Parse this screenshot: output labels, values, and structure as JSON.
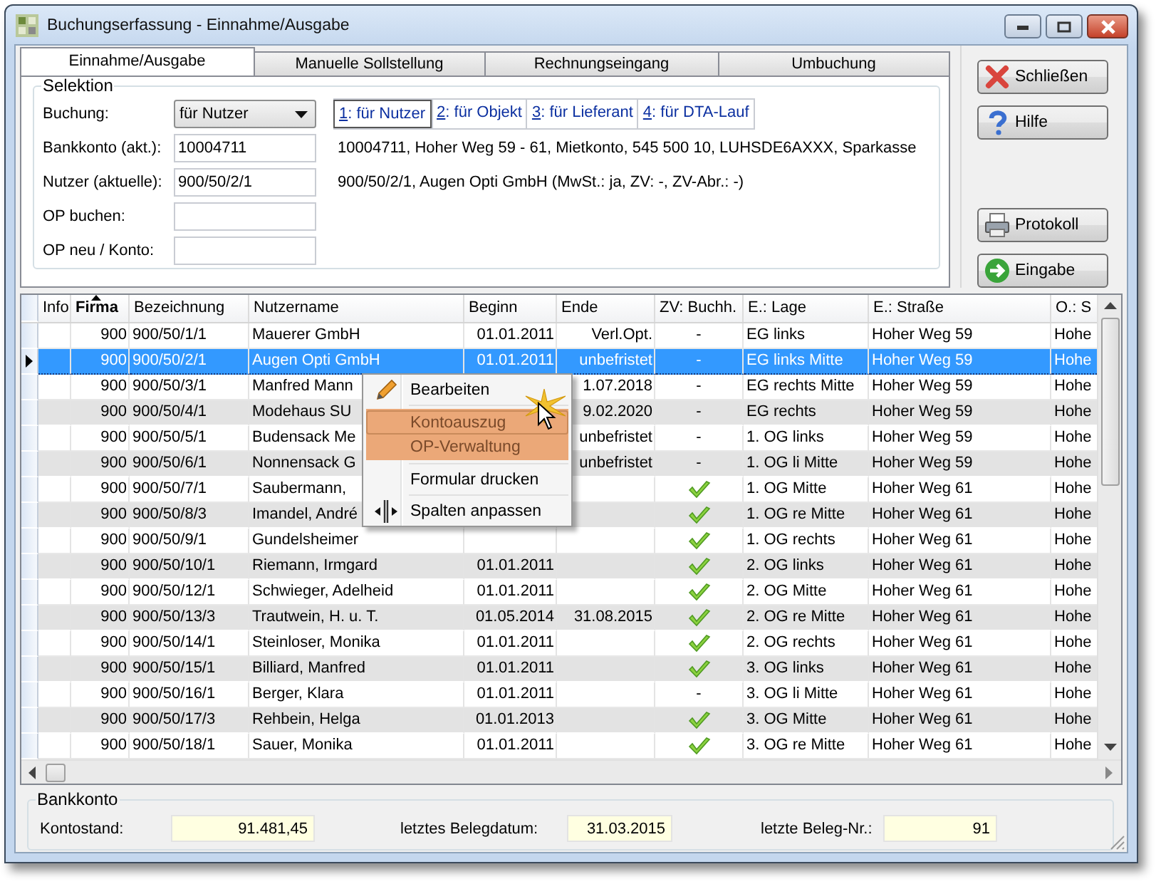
{
  "window": {
    "title": "Buchungserfassung - Einnahme/Ausgabe"
  },
  "tabs": [
    {
      "label": "Einnahme/Ausgabe",
      "selected": true
    },
    {
      "label": "Manuelle Sollstellung",
      "selected": false
    },
    {
      "label": "Rechnungseingang",
      "selected": false
    },
    {
      "label": "Umbuchung",
      "selected": false
    }
  ],
  "selektion": {
    "title": "Selektion",
    "fields": [
      {
        "label": "Buchung:",
        "kind": "dropdown",
        "value": "für Nutzer"
      },
      {
        "label": "Bankkonto (akt.):",
        "kind": "text",
        "value": "10004711",
        "info": "10004711,  Hoher Weg 59 - 61,  Mietkonto,  545 500 10,  LUHSDE6AXXX,  Sparkasse"
      },
      {
        "label": "Nutzer (aktuelle):",
        "kind": "text",
        "value": "900/50/2/1",
        "info": "900/50/2/1,  Augen Opti GmbH  (MwSt.: ja,  ZV: -, ZV-Abr.: -)"
      },
      {
        "label": "OP buchen:",
        "kind": "text"
      },
      {
        "label": "OP neu / Konto:",
        "kind": "text"
      }
    ],
    "links": [
      {
        "key": "1",
        "label": ": für Nutzer",
        "selected": true
      },
      {
        "key": "2",
        "label": ": für Objekt",
        "selected": false
      },
      {
        "key": "3",
        "label": ": für Lieferant",
        "selected": false
      },
      {
        "key": "4",
        "label": ": für DTA-Lauf",
        "selected": false
      }
    ]
  },
  "buttons": [
    {
      "label": "Schließen",
      "kind": "close"
    },
    {
      "label": "Hilfe",
      "kind": "help"
    },
    {
      "label": "Protokoll",
      "kind": "print"
    },
    {
      "label": "Eingabe",
      "kind": "enter"
    }
  ],
  "table": {
    "columns": [
      {
        "label": "Info"
      },
      {
        "label": "Firma",
        "sorted": true
      },
      {
        "label": "Bezeichnung"
      },
      {
        "label": "Nutzername"
      },
      {
        "label": "Beginn"
      },
      {
        "label": "Ende"
      },
      {
        "label": "ZV: Buchh."
      },
      {
        "label": "E.: Lage"
      },
      {
        "label": "E.: Straße"
      },
      {
        "label": "O.: S"
      }
    ],
    "rows": [
      {
        "selected": false,
        "firma": "900",
        "bez": "900/50/1/1",
        "name": "Mauerer GmbH",
        "beginn": "01.01.2011",
        "ende": "Verl.Opt.",
        "zv_booked": false,
        "zv": "-",
        "lage": "EG links",
        "strasse": "Hoher Weg 59",
        "column_10": "Hohe"
      },
      {
        "selected": true,
        "firma": "900",
        "bez": "900/50/2/1",
        "name": "Augen Opti GmbH",
        "beginn": "01.01.2011",
        "ende": "unbefristet",
        "zv_booked": false,
        "zv": "-",
        "lage": "EG links Mitte",
        "strasse": "Hoher Weg 59",
        "column_10": "Hohe"
      },
      {
        "selected": false,
        "firma": "900",
        "bez": "900/50/3/1",
        "name": "Manfred Mann",
        "ende": "1.07.2018",
        "zv_booked": false,
        "zv": "-",
        "lage": "EG rechts Mitte",
        "strasse": "Hoher Weg 59",
        "column_10": "Hohe"
      },
      {
        "selected": false,
        "firma": "900",
        "bez": "900/50/4/1",
        "name": "Modehaus SU",
        "ende": "9.02.2020",
        "zv_booked": false,
        "zv": "-",
        "lage": "EG rechts",
        "strasse": "Hoher Weg 59",
        "column_10": "Hohe"
      },
      {
        "selected": false,
        "firma": "900",
        "bez": "900/50/5/1",
        "name": "Budensack Me",
        "ende": "unbefristet",
        "zv_booked": false,
        "zv": "-",
        "lage": "1. OG links",
        "strasse": "Hoher Weg 59",
        "column_10": "Hohe"
      },
      {
        "selected": false,
        "firma": "900",
        "bez": "900/50/6/1",
        "name": "Nonnensack G",
        "ende": "unbefristet",
        "zv_booked": false,
        "zv": "-",
        "lage": "1. OG li Mitte",
        "strasse": "Hoher Weg 59",
        "column_10": "Hohe"
      },
      {
        "selected": false,
        "firma": "900",
        "bez": "900/50/7/1",
        "name": "Saubermann,",
        "zv_booked": true,
        "lage": "1. OG Mitte",
        "strasse": "Hoher Weg 61",
        "column_10": "Hohe"
      },
      {
        "selected": false,
        "firma": "900",
        "bez": "900/50/8/3",
        "name": "Imandel, André",
        "zv_booked": true,
        "lage": "1. OG re Mitte",
        "strasse": "Hoher Weg 61",
        "column_10": "Hohe"
      },
      {
        "selected": false,
        "firma": "900",
        "bez": "900/50/9/1",
        "name": "Gundelsheimer",
        "zv_booked": true,
        "lage": "1. OG rechts",
        "strasse": "Hoher Weg 61",
        "column_10": "Hohe"
      },
      {
        "selected": false,
        "firma": "900",
        "bez": "900/50/10/1",
        "name": "Riemann, Irmgard",
        "beginn": "01.01.2011",
        "zv_booked": true,
        "lage": "2. OG links",
        "strasse": "Hoher Weg 61",
        "column_10": "Hohe"
      },
      {
        "selected": false,
        "firma": "900",
        "bez": "900/50/12/1",
        "name": "Schwieger, Adelheid",
        "beginn": "01.01.2011",
        "zv_booked": true,
        "lage": "2. OG Mitte",
        "strasse": "Hoher Weg 61",
        "column_10": "Hohe"
      },
      {
        "selected": false,
        "firma": "900",
        "bez": "900/50/13/3",
        "name": "Trautwein, H. u. T.",
        "beginn": "01.05.2014",
        "ende": "31.08.2015",
        "zv_booked": true,
        "lage": "2. OG re Mitte",
        "strasse": "Hoher Weg 61",
        "column_10": "Hohe"
      },
      {
        "selected": false,
        "firma": "900",
        "bez": "900/50/14/1",
        "name": "Steinloser, Monika",
        "beginn": "01.01.2011",
        "zv_booked": true,
        "lage": "2. OG rechts",
        "strasse": "Hoher Weg 61",
        "column_10": "Hohe"
      },
      {
        "selected": false,
        "firma": "900",
        "bez": "900/50/15/1",
        "name": "Billiard, Manfred",
        "beginn": "01.01.2011",
        "zv_booked": true,
        "lage": "3. OG links",
        "strasse": "Hoher Weg 61",
        "column_10": "Hohe"
      },
      {
        "selected": false,
        "firma": "900",
        "bez": "900/50/16/1",
        "name": "Berger, Klara",
        "beginn": "01.01.2011",
        "zv_booked": false,
        "zv": "-",
        "lage": "3. OG li Mitte",
        "strasse": "Hoher Weg 61",
        "column_10": "Hohe"
      },
      {
        "selected": false,
        "firma": "900",
        "bez": "900/50/17/3",
        "name": "Rehbein, Helga",
        "beginn": "01.01.2013",
        "zv_booked": true,
        "lage": "3. OG Mitte",
        "strasse": "Hoher Weg 61",
        "column_10": "Hohe"
      },
      {
        "selected": false,
        "firma": "900",
        "bez": "900/50/18/1",
        "name": "Sauer, Monika",
        "beginn": "01.01.2011",
        "zv_booked": true,
        "lage": "3. OG re Mitte",
        "strasse": "Hoher Weg 61",
        "column_10": "Hohe"
      }
    ]
  },
  "context_menu": {
    "items": [
      {
        "label": "Bearbeiten",
        "kind": "edit",
        "highlighted": false,
        "selected": false
      },
      {
        "label": "Kontoauszug",
        "highlighted": true,
        "selected": true,
        "separator_before": true
      },
      {
        "label": "OP-Verwaltung",
        "highlighted": true,
        "selected": false
      },
      {
        "label": "Formular drucken",
        "highlighted": false,
        "selected": false,
        "separator_before": true
      },
      {
        "label": "Spalten anpassen",
        "kind": "columns",
        "highlighted": false,
        "selected": false,
        "separator_before": true
      }
    ]
  },
  "bankkonto": {
    "title": "Bankkonto",
    "fields": [
      {
        "label": "Kontostand:",
        "value": "91.481,45"
      },
      {
        "label": "letztes Belegdatum:",
        "value": "31.03.2015"
      },
      {
        "label": "letzte Beleg-Nr.:",
        "value": "91"
      }
    ]
  }
}
